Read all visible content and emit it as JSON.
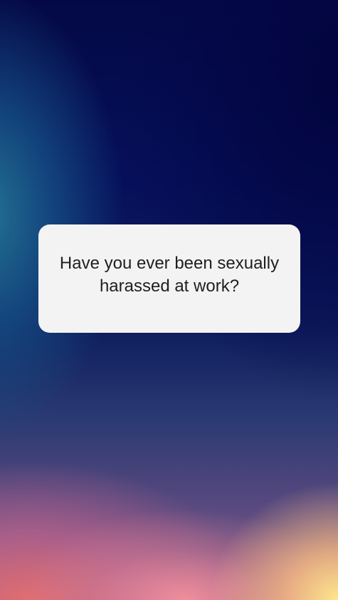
{
  "card": {
    "question": "Have you ever been sexually harassed at work?"
  },
  "colors": {
    "background_top": "#040946",
    "background_teal": "#2478a0",
    "background_warm": "#e66e6e",
    "background_yellow": "#ffe68c",
    "card_background": "#f3f3f3",
    "text": "#1f1f1f"
  }
}
